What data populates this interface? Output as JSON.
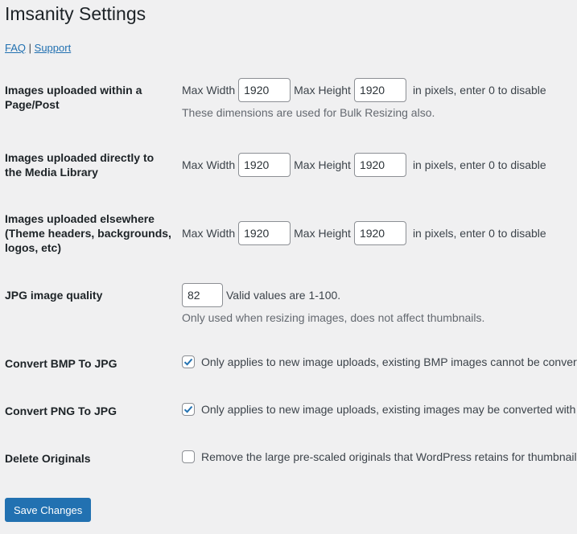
{
  "page": {
    "title": "Imsanity Settings",
    "links": [
      {
        "label": "FAQ"
      },
      {
        "label": "Support"
      }
    ],
    "separator": "|"
  },
  "dimension_rows": [
    {
      "label": "Images uploaded within a Page/Post",
      "max_width_label": "Max Width",
      "max_width": "1920",
      "max_height_label": "Max Height",
      "max_height": "1920",
      "suffix": "in pixels, enter 0 to disable",
      "description": "These dimensions are used for Bulk Resizing also."
    },
    {
      "label": "Images uploaded directly to the Media Library",
      "max_width_label": "Max Width",
      "max_width": "1920",
      "max_height_label": "Max Height",
      "max_height": "1920",
      "suffix": "in pixels, enter 0 to disable"
    },
    {
      "label": "Images uploaded elsewhere (Theme headers, backgrounds, logos, etc)",
      "max_width_label": "Max Width",
      "max_width": "1920",
      "max_height_label": "Max Height",
      "max_height": "1920",
      "suffix": "in pixels, enter 0 to disable"
    }
  ],
  "quality": {
    "label": "JPG image quality",
    "value": "82",
    "suffix": "Valid values are 1-100.",
    "description": "Only used when resizing images, does not affect thumbnails."
  },
  "options": [
    {
      "label": "Convert BMP To JPG",
      "checked": true,
      "text": "Only applies to new image uploads, existing BMP images cannot be converted with Imsanity."
    },
    {
      "label": "Convert PNG To JPG",
      "checked": true,
      "text": "Only applies to new image uploads, existing images may be converted with Bulk Resize."
    },
    {
      "label": "Delete Originals",
      "checked": false,
      "text": "Remove the large pre-scaled originals that WordPress retains for thumbnail generation."
    }
  ],
  "save_label": "Save Changes",
  "colors": {
    "accent": "#2271b1",
    "background": "#f0f0f1"
  }
}
